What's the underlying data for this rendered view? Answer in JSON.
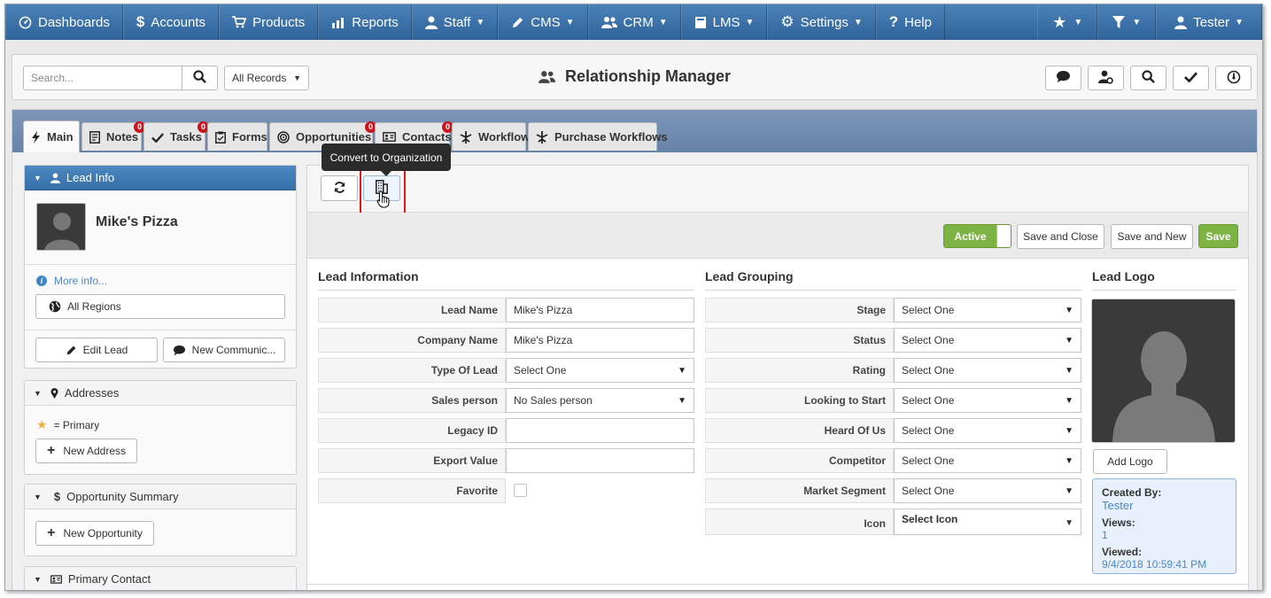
{
  "nav": {
    "items": [
      {
        "label": "Dashboards",
        "icon": "dashboard-icon",
        "caret": false
      },
      {
        "label": "Accounts",
        "icon": "dollar-icon",
        "caret": false
      },
      {
        "label": "Products",
        "icon": "cart-icon",
        "caret": false
      },
      {
        "label": "Reports",
        "icon": "chart-icon",
        "caret": false
      },
      {
        "label": "Staff",
        "icon": "user-icon",
        "caret": true
      },
      {
        "label": "CMS",
        "icon": "pencil-icon",
        "caret": true
      },
      {
        "label": "CRM",
        "icon": "users-icon",
        "caret": true
      },
      {
        "label": "LMS",
        "icon": "book-icon",
        "caret": true
      },
      {
        "label": "Settings",
        "icon": "gear-icon",
        "caret": true
      },
      {
        "label": "Help",
        "icon": "question-icon",
        "caret": false
      }
    ],
    "right": [
      {
        "label": "",
        "icon": "star-icon",
        "caret": true
      },
      {
        "label": "",
        "icon": "filter-icon",
        "caret": true
      },
      {
        "label": "Tester",
        "icon": "user-icon",
        "caret": true
      }
    ]
  },
  "header": {
    "search_placeholder": "Search...",
    "records_select": "All Records",
    "title": "Relationship Manager"
  },
  "tabs": [
    {
      "label": "Main",
      "icon": "bolt-icon",
      "badge": ""
    },
    {
      "label": "Notes",
      "icon": "notes-icon",
      "badge": "0"
    },
    {
      "label": "Tasks",
      "icon": "check-icon",
      "badge": "0"
    },
    {
      "label": "Forms",
      "icon": "clipboard-icon",
      "badge": ""
    },
    {
      "label": "Opportunities",
      "icon": "target-icon",
      "badge": "0"
    },
    {
      "label": "Contacts",
      "icon": "contact-card-icon",
      "badge": "0"
    },
    {
      "label": "Workflow",
      "icon": "workflow-icon",
      "badge": ""
    },
    {
      "label": "Purchase Workflows",
      "icon": "workflow-icon",
      "badge": ""
    }
  ],
  "sidebar": {
    "lead_info": {
      "title": "Lead Info",
      "name": "Mike's Pizza",
      "more_info": "More info...",
      "regions_button": "All Regions",
      "edit_button": "Edit Lead",
      "new_comm_button": "New Communic..."
    },
    "addresses": {
      "title": "Addresses",
      "primary_legend": "= Primary",
      "new_button": "New Address"
    },
    "opportunity": {
      "title": "Opportunity Summary",
      "new_button": "New Opportunity"
    },
    "primary_contact": {
      "title": "Primary Contact"
    }
  },
  "toolbar": {
    "tooltip": "Convert to Organization"
  },
  "actions": {
    "active_toggle": "Active",
    "save_close": "Save and Close",
    "save_new": "Save and New",
    "save": "Save"
  },
  "lead_information": {
    "title": "Lead Information",
    "fields": [
      {
        "label": "Lead Name",
        "value": "Mike's Pizza",
        "type": "text"
      },
      {
        "label": "Company Name",
        "value": "Mike's Pizza",
        "type": "text"
      },
      {
        "label": "Type Of Lead",
        "value": "Select One",
        "type": "select"
      },
      {
        "label": "Sales person",
        "value": "No Sales person",
        "type": "select"
      },
      {
        "label": "Legacy ID",
        "value": "",
        "type": "text"
      },
      {
        "label": "Export Value",
        "value": "",
        "type": "text"
      },
      {
        "label": "Favorite",
        "value": "",
        "type": "checkbox"
      }
    ]
  },
  "lead_grouping": {
    "title": "Lead Grouping",
    "fields": [
      {
        "label": "Stage",
        "value": "Select One",
        "type": "select"
      },
      {
        "label": "Status",
        "value": "Select One",
        "type": "select"
      },
      {
        "label": "Rating",
        "value": "Select One",
        "type": "select"
      },
      {
        "label": "Looking to Start",
        "value": "Select One",
        "type": "select"
      },
      {
        "label": "Heard Of Us",
        "value": "Select One",
        "type": "select"
      },
      {
        "label": "Competitor",
        "value": "Select One",
        "type": "select"
      },
      {
        "label": "Market Segment",
        "value": "Select One",
        "type": "select"
      },
      {
        "label": "Icon",
        "value": "Select Icon",
        "type": "icon-select"
      }
    ]
  },
  "lead_logo": {
    "title": "Lead Logo",
    "add_button": "Add Logo",
    "created_by_label": "Created By:",
    "created_by": "Tester",
    "views_label": "Views:",
    "views": "1",
    "viewed_label": "Viewed:",
    "viewed": "9/4/2018 10:59:41 PM"
  }
}
